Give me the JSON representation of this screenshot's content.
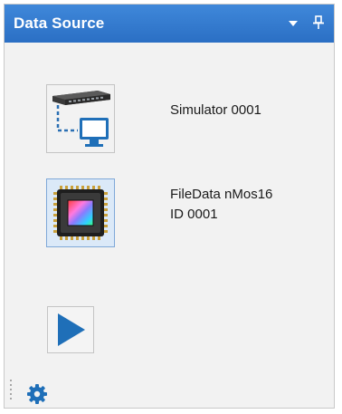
{
  "panel": {
    "title": "Data Source"
  },
  "titlebar_buttons": {
    "dropdown_icon": "chevron-down-icon",
    "pin_icon": "pin-icon"
  },
  "sources": [
    {
      "icon": "network-simulator-icon",
      "line1": "Simulator 0001",
      "line2": "",
      "selected": false
    },
    {
      "icon": "sensor-chip-icon",
      "line1": "FileData nMos16",
      "line2": "ID 0001",
      "selected": true
    }
  ],
  "controls": {
    "play_icon": "play-icon",
    "settings_icon": "gear-icon"
  },
  "colors": {
    "titlebar": "#2f78cf",
    "accent_blue": "#1f6fb8",
    "selected_tile": "#dbe9f8"
  }
}
